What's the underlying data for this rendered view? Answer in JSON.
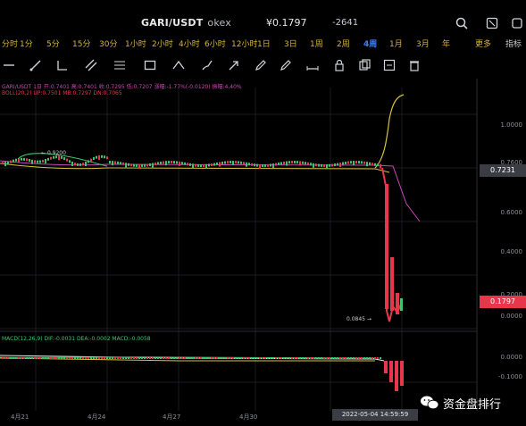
{
  "header": {
    "pair": "GARI/USDT",
    "exchange": "okex",
    "price": "0.1797",
    "change": "-2641"
  },
  "intervals": {
    "items": [
      "1分",
      "5分",
      "15分",
      "30分",
      "1小时",
      "2小时",
      "4小时",
      "6小时",
      "12小时",
      "1日",
      "3日",
      "1周",
      "2周",
      "4周",
      "1月",
      "3月",
      "年"
    ],
    "selected_index": 13,
    "left_label": "分时",
    "right_label": "更多",
    "far_right_label": "指标"
  },
  "legend": {
    "line1": "GARI/USDT 1日 开:0.7401 高:0.7401 收:0.7295 低:0.7207 涨幅:-1.77%(-0.0120) 振幅:4.40%",
    "line2": "BOLL(20,2) UP:0.7501 MB:0.7297 DN:0.7065"
  },
  "price_axis": {
    "labels": [
      "1.0000",
      "0.7600",
      "0.6000",
      "0.4000",
      "0.2000",
      "0.0000"
    ],
    "current_tag": "0.7231",
    "last_tag": "0.1797",
    "last_tag_color": "#e8364a"
  },
  "annotations": {
    "high": "0.9200",
    "low": "0.0845"
  },
  "macd": {
    "legend": "MACD(12,26,9) DIF:-0.0031 DEA:-0.0002 MACD:-0.0058",
    "axis_labels": [
      "0.0000",
      "-0.1000"
    ]
  },
  "time_axis": {
    "labels": [
      "4月21",
      "4月24",
      "4月27",
      "4月30"
    ],
    "crosshair_time": "2022-05-04 14:59:59"
  },
  "watermark": {
    "text": "资金盘排行"
  },
  "colors": {
    "background": "#000000",
    "up": "#3ec46d",
    "down": "#e8364a",
    "accent": "#3b82f6",
    "yellow": "#d6c23a"
  }
}
